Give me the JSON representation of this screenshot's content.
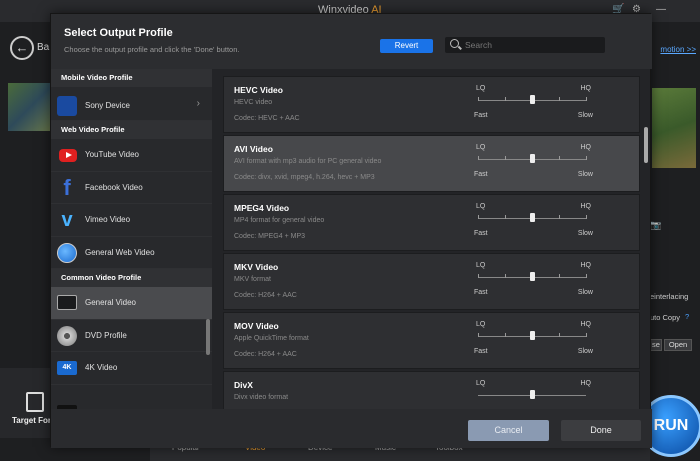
{
  "app": {
    "title_main": "Winxvideo",
    "title_ai": "AI"
  },
  "background": {
    "back_label": "Ba",
    "promotion_link": "motion >>",
    "deinterlacing": "einterlacing",
    "auto_copy": "uto Copy",
    "btn_left": "se",
    "btn_open": "Open",
    "target_label": "Target For",
    "run_label": "RUN",
    "tabs": [
      "Popular",
      "Video",
      "Device",
      "Music",
      "Toolbox"
    ]
  },
  "dialog": {
    "title": "Select Output Profile",
    "subtitle": "Choose the output profile and click the 'Done' button.",
    "revert_label": "Revert",
    "search_placeholder": "Search",
    "cancel_label": "Cancel",
    "done_label": "Done"
  },
  "sidebar": {
    "sections": [
      {
        "header": "Mobile Video Profile",
        "items": [
          {
            "label": "Sony Device",
            "icon": "playstation-icon",
            "chevron": "›"
          }
        ]
      },
      {
        "header": "Web Video Profile",
        "items": [
          {
            "label": "YouTube Video",
            "icon": "youtube-icon"
          },
          {
            "label": "Facebook Video",
            "icon": "facebook-icon"
          },
          {
            "label": "Vimeo Video",
            "icon": "vimeo-icon"
          },
          {
            "label": "General Web Video",
            "icon": "globe-icon"
          }
        ]
      },
      {
        "header": "Common Video Profile",
        "items": [
          {
            "label": "General Video",
            "icon": "monitor-icon",
            "selected": true
          },
          {
            "label": "DVD Profile",
            "icon": "dvd-icon"
          },
          {
            "label": "4K Video",
            "icon": "4k-icon",
            "badge": "4K"
          },
          {
            "label": "",
            "icon": "film-icon"
          }
        ]
      }
    ]
  },
  "slider_labels": {
    "lq": "LQ",
    "hq": "HQ",
    "fast": "Fast",
    "slow": "Slow"
  },
  "profiles": [
    {
      "name": "HEVC Video",
      "desc": "HEVC video",
      "codec": "Codec: HEVC + AAC",
      "quality": 0.5,
      "selected": false
    },
    {
      "name": "AVI Video",
      "desc": "AVI format with mp3 audio for PC general video",
      "codec": "Codec: divx, xvid, mpeg4, h.264, hevc + MP3",
      "quality": 0.5,
      "selected": true
    },
    {
      "name": "MPEG4 Video",
      "desc": "MP4 format for general video",
      "codec": "Codec: MPEG4 + MP3",
      "quality": 0.5,
      "selected": false
    },
    {
      "name": "MKV Video",
      "desc": "MKV format",
      "codec": "Codec: H264 + AAC",
      "quality": 0.5,
      "selected": false
    },
    {
      "name": "MOV Video",
      "desc": "Apple QuickTime format",
      "codec": "Codec: H264 + AAC",
      "quality": 0.5,
      "selected": false
    },
    {
      "name": "DivX",
      "desc": "Divx video format",
      "codec": "",
      "quality": 0.5,
      "selected": false
    }
  ]
}
